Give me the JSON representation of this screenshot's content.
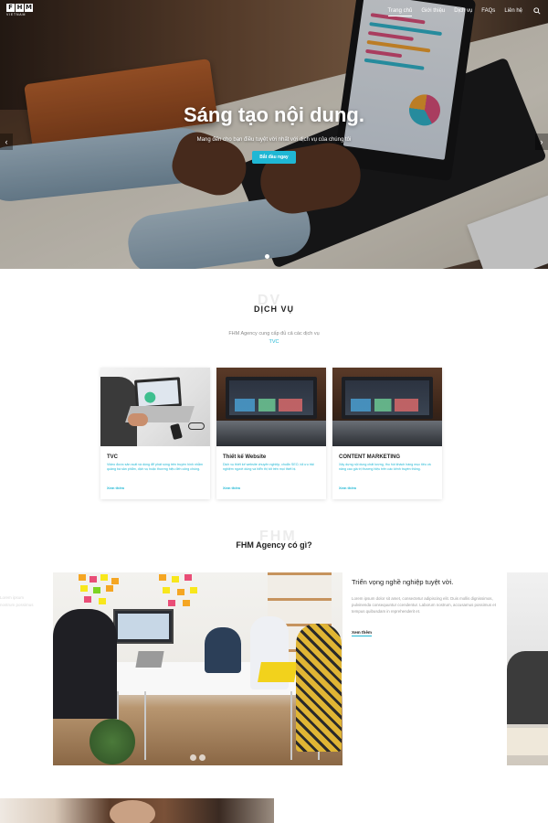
{
  "nav": {
    "logo_letters": [
      "F",
      "H",
      "M"
    ],
    "logo_sub": "VIETNAM",
    "items": [
      {
        "label": "Trang chủ",
        "active": true
      },
      {
        "label": "Giới thiệu",
        "active": false
      },
      {
        "label": "Dịch vụ",
        "active": false
      },
      {
        "label": "FAQs",
        "active": false
      },
      {
        "label": "Liên hệ",
        "active": false
      }
    ],
    "search_icon": "search-icon"
  },
  "hero": {
    "title": "Sáng tạo nội dung.",
    "subtitle": "Mang đến cho bạn điều tuyệt vời nhất với dịch vụ của chúng tôi",
    "button": "Bắt đầu ngay",
    "prev_icon": "‹",
    "next_icon": "›"
  },
  "services": {
    "ghost": "DV",
    "title": "DỊCH VỤ",
    "description": "FHM Agency cung cấp đủ cả các dịch vụ",
    "highlight": "TVC",
    "cards": [
      {
        "title": "TVC",
        "text": "Video được sản xuất và dùng để phát sóng trên truyền hình nhằm quảng bá sản phẩm, dịch vụ hoặc thương hiệu đến công chúng.",
        "more": "Xem thêm"
      },
      {
        "title": "Thiết kế Website",
        "text": "Dịch vụ thiết kế website chuyên nghiệp, chuẩn SEO, tối ưu trải nghiệm người dùng và hiển thị tốt trên mọi thiết bị.",
        "more": "Xem thêm"
      },
      {
        "title": "CONTENT MARKETING",
        "text": "Xây dựng nội dung chất lượng, thu hút khách hàng mục tiêu và nâng cao giá trị thương hiệu trên các kênh truyền thông.",
        "more": "Xem thêm"
      }
    ]
  },
  "fhm": {
    "ghost": "FHM",
    "title": "FHM Agency có gì?",
    "slide_heading": "Triển vọng nghề nghiệp tuyệt vời.",
    "slide_text": "Lorem ipsum dolor sit amet, consectetur adipiscing elit. Duis mollis dignissimos, pulvinenda consequuntur ccendentur. Laborum nostrum, accusamus possimus et tempus quibusdam in reprehenderit et.",
    "slide_more": "Xem thêm",
    "left_ghost": [
      "Lorem ipsum",
      "nostrum possimus"
    ]
  },
  "colors": {
    "accent": "#1fb7d4",
    "heading": "#1f1f1f",
    "muted": "#9a9a9a"
  }
}
